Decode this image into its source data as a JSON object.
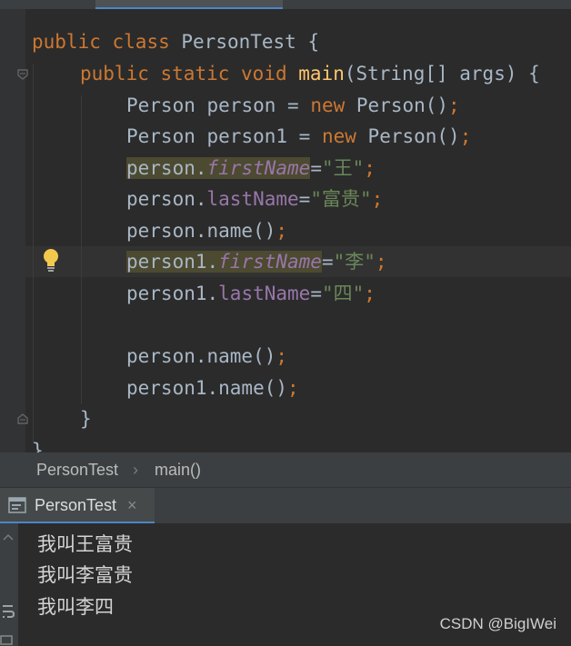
{
  "editor": {
    "lines": [
      {
        "kw1": "public",
        "kw2": "class",
        "name": "PersonTest",
        "tail": " {"
      },
      {
        "kw1": "public",
        "kw2": "static",
        "kw3": "void",
        "method": "main",
        "params": "(String[] args) {"
      },
      {
        "type": "Person",
        "var": "person",
        "eq": " = ",
        "kwnew": "new",
        "ctor": " Person()",
        "semi": ";"
      },
      {
        "type": "Person",
        "var": "person1",
        "eq": " = ",
        "kwnew": "new",
        "ctor": " Person()",
        "semi": ";"
      },
      {
        "obj": "person.",
        "field": "firstName",
        "eq": "=",
        "val": "\"王\"",
        "semi": ";"
      },
      {
        "obj": "person.",
        "field": "lastName",
        "eq": "=",
        "val": "\"富贵\"",
        "semi": ";"
      },
      {
        "call": "person.name()",
        "semi": ";"
      },
      {
        "obj": "person1.",
        "field": "firstName",
        "eq": "=",
        "val": "\"李\"",
        "semi": ";"
      },
      {
        "obj": "person1.",
        "field": "lastName",
        "eq": "=",
        "val": "\"四\"",
        "semi": ";"
      },
      {
        "call": "person.name()",
        "semi": ";"
      },
      {
        "call": "person1.name()",
        "semi": ";"
      },
      {
        "brace": "}"
      },
      {
        "brace": "}"
      }
    ]
  },
  "breadcrumb": {
    "file": "PersonTest",
    "sep": "›",
    "method": "main()"
  },
  "run": {
    "tab_label": "PersonTest",
    "close": "×"
  },
  "console": {
    "lines": [
      "我叫王富贵",
      "我叫李富贵",
      "我叫李四"
    ]
  },
  "watermark": "CSDN @BigIWei",
  "icons": {
    "bulb": "lightbulb-icon",
    "fold": "fold-icon",
    "run": "run-console-icon"
  },
  "colors": {
    "keyword": "#cc7832",
    "method": "#ffc66d",
    "string": "#6a8759",
    "field": "#9876aa",
    "text": "#a9b7c6"
  }
}
